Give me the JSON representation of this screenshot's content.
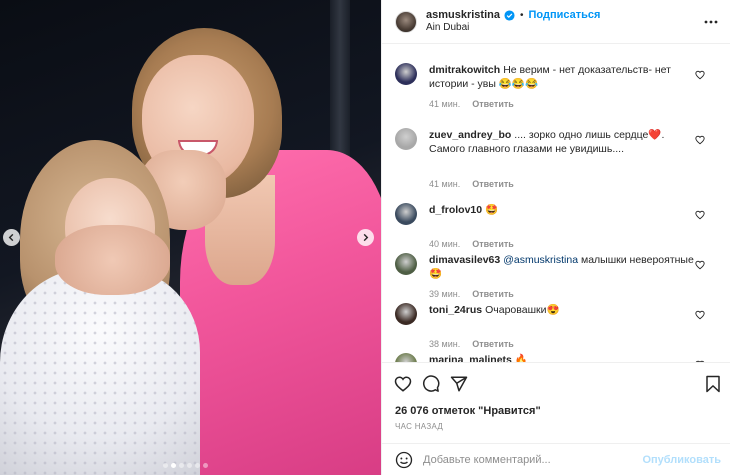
{
  "post": {
    "username": "asmuskristina",
    "follow_label": "Подписаться",
    "location": "Ain Dubai",
    "separator": "•"
  },
  "comments": [
    {
      "username": "dmitrakowitch",
      "text": "Не верим - нет доказательств- нет истории - увы 😂😂😂",
      "time": "41 мин.",
      "reply_label": "Ответить",
      "avatar_color": "#2d2f5a"
    },
    {
      "username": "zuev_andrey_bo",
      "text": ".... зорко одно лишь сердце❤️. Самого главного глазами не увидишь....",
      "time": "41 мин.",
      "reply_label": "Ответить",
      "avatar_color": "#a8a8a8"
    },
    {
      "username": "d_frolov10",
      "text": "🤩",
      "time": "40 мин.",
      "reply_label": "Ответить",
      "avatar_color": "#3a4a5e"
    },
    {
      "username": "dimavasilev63",
      "mention": "@asmuskristina",
      "text": "малышки невероятные 🤩",
      "time": "39 мин.",
      "reply_label": "Ответить",
      "avatar_color": "#4e5e44"
    },
    {
      "username": "toni_24rus",
      "text": "Очаровашки😍",
      "time": "38 мин.",
      "reply_label": "Ответить",
      "avatar_color": "#3b2a24"
    },
    {
      "username": "marina_malinets",
      "text": "🔥",
      "time": "",
      "reply_label": "",
      "avatar_color": "#6a7a4a"
    }
  ],
  "likes": {
    "text": "26 076 отметок \"Нравится\""
  },
  "timestamp": "ЧАС НАЗАД",
  "comment_box": {
    "placeholder": "Добавьте комментарий...",
    "publish_label": "Опубликовать"
  },
  "colors": {
    "accent": "#0095f6",
    "verified": "#0095f6",
    "muted": "#8e8e8e",
    "publish_disabled": "#b2dffc"
  },
  "icons": [
    "verified-badge-icon",
    "more-icon",
    "heart-icon",
    "comment-icon",
    "share-icon",
    "bookmark-icon",
    "emoji-icon",
    "chevron-left-icon",
    "chevron-right-icon"
  ],
  "carousel": {
    "count": 6,
    "active_index": 1
  }
}
